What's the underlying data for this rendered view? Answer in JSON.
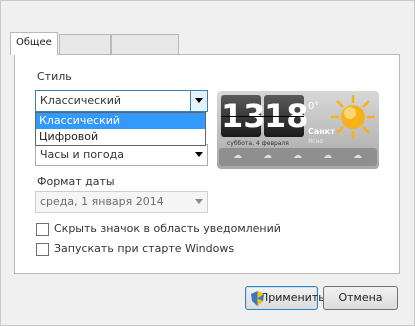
{
  "tabs": [
    {
      "label": "Общее"
    },
    {
      "label": ""
    },
    {
      "label": ""
    }
  ],
  "style": {
    "label": "Стиль",
    "value": "Классический",
    "options": [
      "Классический",
      "Цифровой"
    ]
  },
  "second_combo": {
    "value": "Часы и погода"
  },
  "preview": {
    "time_hours": "13",
    "time_minutes": "18",
    "temperature": "0°",
    "city": "Санкт",
    "date_line": "суббота, 4 февраля",
    "weather_line": "Ясно"
  },
  "date_format": {
    "label": "Формат даты",
    "value": "среда, 1 января 2014"
  },
  "checkboxes": {
    "hide_icon": "Скрыть значок в область уведомлений",
    "autostart": "Запускать при старте Windows"
  },
  "buttons": {
    "apply": "Применить",
    "cancel": "Отмена"
  },
  "colors": {
    "accent": "#3399ff",
    "sun": "#f6b21b"
  },
  "icons": [
    "chevron-down-icon",
    "uac-shield-icon",
    "sun-icon",
    "cloud-icon"
  ]
}
